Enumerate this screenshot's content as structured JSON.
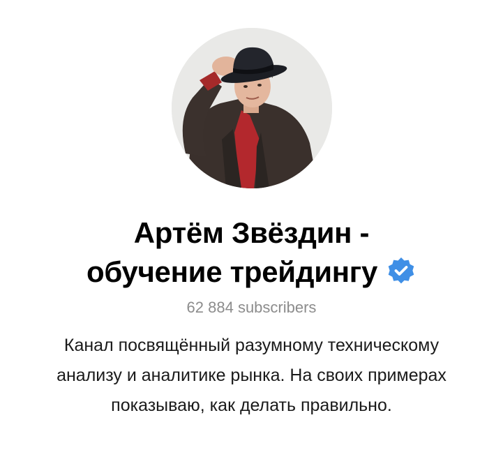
{
  "channel": {
    "avatar": {
      "icon": "channel-avatar-photo"
    },
    "title_lines": [
      "Артём Звёздин -",
      "обучение трейдингу"
    ],
    "verified": {
      "icon": "verified-badge-icon",
      "color": "#3f8fe6"
    },
    "subscribers": "62 884 subscribers",
    "description_lines": [
      "Канал посвящённый разумному техническому",
      "анализу и аналитике рынка. На своих примерах",
      "показываю, как делать правильно."
    ]
  }
}
